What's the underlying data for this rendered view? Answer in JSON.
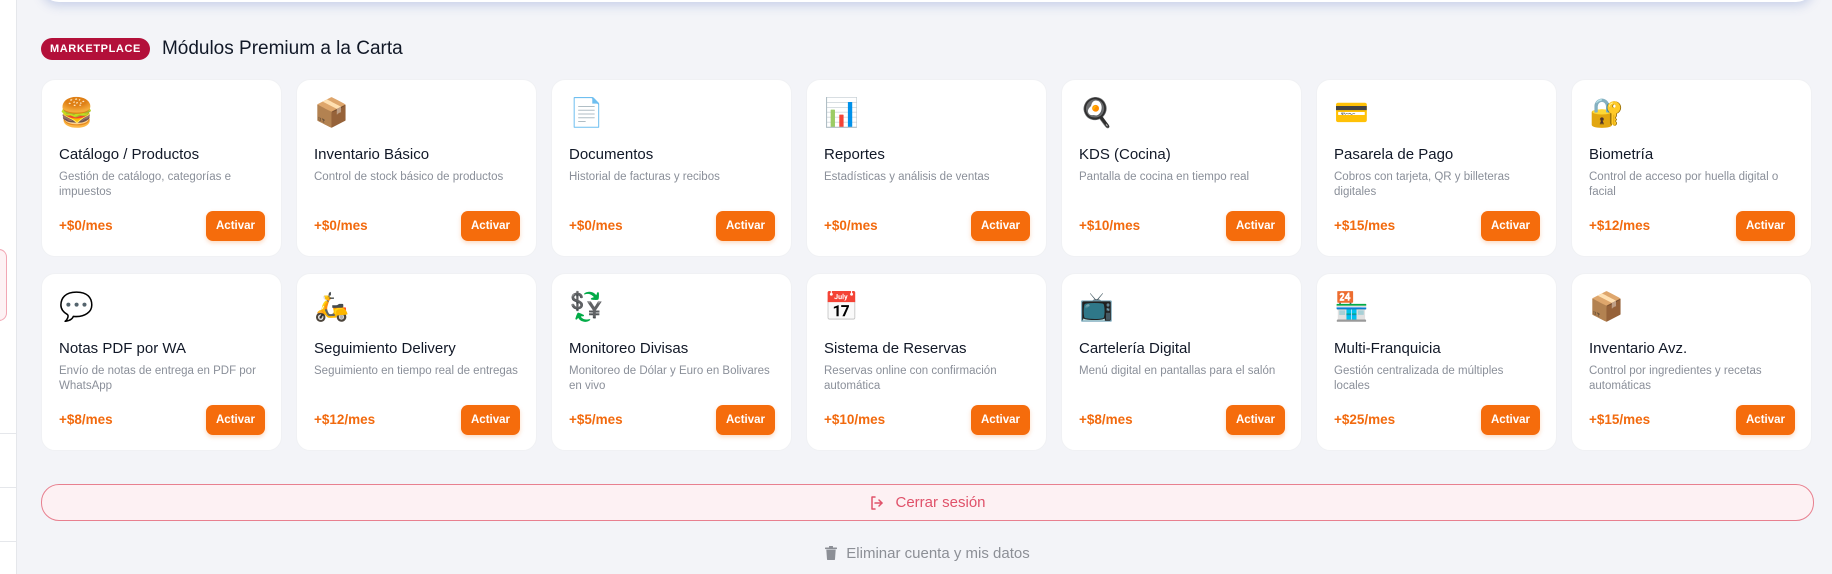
{
  "section": {
    "badge": "MARKETPLACE",
    "title": "Módulos Premium a la Carta"
  },
  "modules": [
    {
      "icon": "🍔",
      "icon_name": "burger-icon",
      "title": "Catálogo / Productos",
      "desc": "Gestión de catálogo, categorías e impuestos",
      "price": "+$0/mes",
      "button": "Activar"
    },
    {
      "icon": "📦",
      "icon_name": "package-icon",
      "title": "Inventario Básico",
      "desc": "Control de stock básico de productos",
      "price": "+$0/mes",
      "button": "Activar"
    },
    {
      "icon": "📄",
      "icon_name": "document-icon",
      "title": "Documentos",
      "desc": "Historial de facturas y recibos",
      "price": "+$0/mes",
      "button": "Activar"
    },
    {
      "icon": "📊",
      "icon_name": "bar-chart-icon",
      "title": "Reportes",
      "desc": "Estadísticas y análisis de ventas",
      "price": "+$0/mes",
      "button": "Activar"
    },
    {
      "icon": "🍳",
      "icon_name": "frying-pan-icon",
      "title": "KDS (Cocina)",
      "desc": "Pantalla de cocina en tiempo real",
      "price": "+$10/mes",
      "button": "Activar"
    },
    {
      "icon": "💳",
      "icon_name": "credit-card-icon",
      "title": "Pasarela de Pago",
      "desc": "Cobros con tarjeta, QR y billeteras digitales",
      "price": "+$15/mes",
      "button": "Activar"
    },
    {
      "icon": "🔐",
      "icon_name": "lock-key-icon",
      "title": "Biometría",
      "desc": "Control de acceso por huella digital o facial",
      "price": "+$12/mes",
      "button": "Activar"
    },
    {
      "icon": "💬",
      "icon_name": "speech-bubble-icon",
      "title": "Notas PDF por WA",
      "desc": "Envío de notas de entrega en PDF por WhatsApp",
      "price": "+$8/mes",
      "button": "Activar"
    },
    {
      "icon": "🛵",
      "icon_name": "scooter-icon",
      "title": "Seguimiento Delivery",
      "desc": "Seguimiento en tiempo real de entregas",
      "price": "+$12/mes",
      "button": "Activar"
    },
    {
      "icon": "💱",
      "icon_name": "currency-exchange-icon",
      "title": "Monitoreo Divisas",
      "desc": "Monitoreo de Dólar y Euro en Bolivares en vivo",
      "price": "+$5/mes",
      "button": "Activar"
    },
    {
      "icon": "📅",
      "icon_name": "calendar-icon",
      "title": "Sistema de Reservas",
      "desc": "Reservas online con confirmación automática",
      "price": "+$10/mes",
      "button": "Activar"
    },
    {
      "icon": "📺",
      "icon_name": "television-icon",
      "title": "Cartelería Digital",
      "desc": "Menú digital en pantallas para el salón",
      "price": "+$8/mes",
      "button": "Activar"
    },
    {
      "icon": "🏪",
      "icon_name": "store-icon",
      "title": "Multi-Franquicia",
      "desc": "Gestión centralizada de múltiples locales",
      "price": "+$25/mes",
      "button": "Activar"
    },
    {
      "icon": "📦",
      "icon_name": "package-icon",
      "title": "Inventario Avz.",
      "desc": "Control por ingredientes y recetas automáticas",
      "price": "+$15/mes",
      "button": "Activar"
    }
  ],
  "actions": {
    "logout": "Cerrar sesión",
    "delete_account": "Eliminar cuenta y mis datos"
  },
  "colors": {
    "accent": "#f56c0c",
    "badge": "#b3103a",
    "logout": "#e0526a"
  }
}
